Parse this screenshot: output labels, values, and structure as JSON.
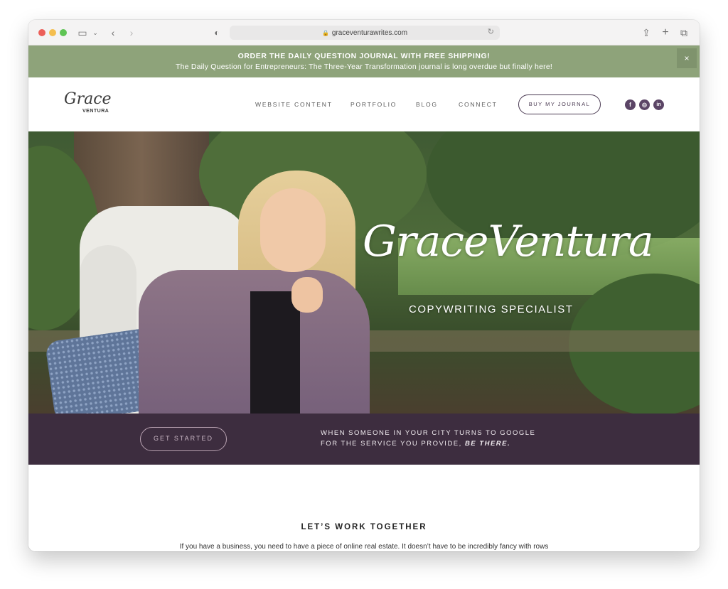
{
  "browser": {
    "url": "graceventurawrites.com"
  },
  "announcement": {
    "title": "ORDER THE DAILY QUESTION JOURNAL WITH FREE SHIPPING!",
    "subtitle": "The Daily Question for Entrepreneurs: The Three-Year Transformation journal is long overdue but finally here!",
    "close": "×"
  },
  "header": {
    "logo_script": "Grace",
    "logo_sub": "VENTURA",
    "nav": [
      "WEBSITE CONTENT",
      "PORTFOLIO",
      "BLOG",
      "CONNECT"
    ],
    "cta": "BUY MY JOURNAL",
    "social": [
      "f",
      "◎",
      "in"
    ]
  },
  "hero": {
    "title": "GraceVentura",
    "subtitle": "COPYWRITING SPECIALIST"
  },
  "band": {
    "button": "GET STARTED",
    "line1": "WHEN SOMEONE IN YOUR CITY TURNS TO GOOGLE",
    "line2": "FOR THE SERVICE YOU PROVIDE,",
    "emphasis": "BE THERE."
  },
  "content": {
    "heading": "LET’S WORK TOGETHER",
    "body": "If you have a business, you need to have a piece of online real estate. It doesn’t have to be incredibly fancy with rows"
  },
  "colors": {
    "announce_bg": "#8ea37a",
    "band_bg": "#3d2d3f",
    "accent": "#5b4566"
  }
}
